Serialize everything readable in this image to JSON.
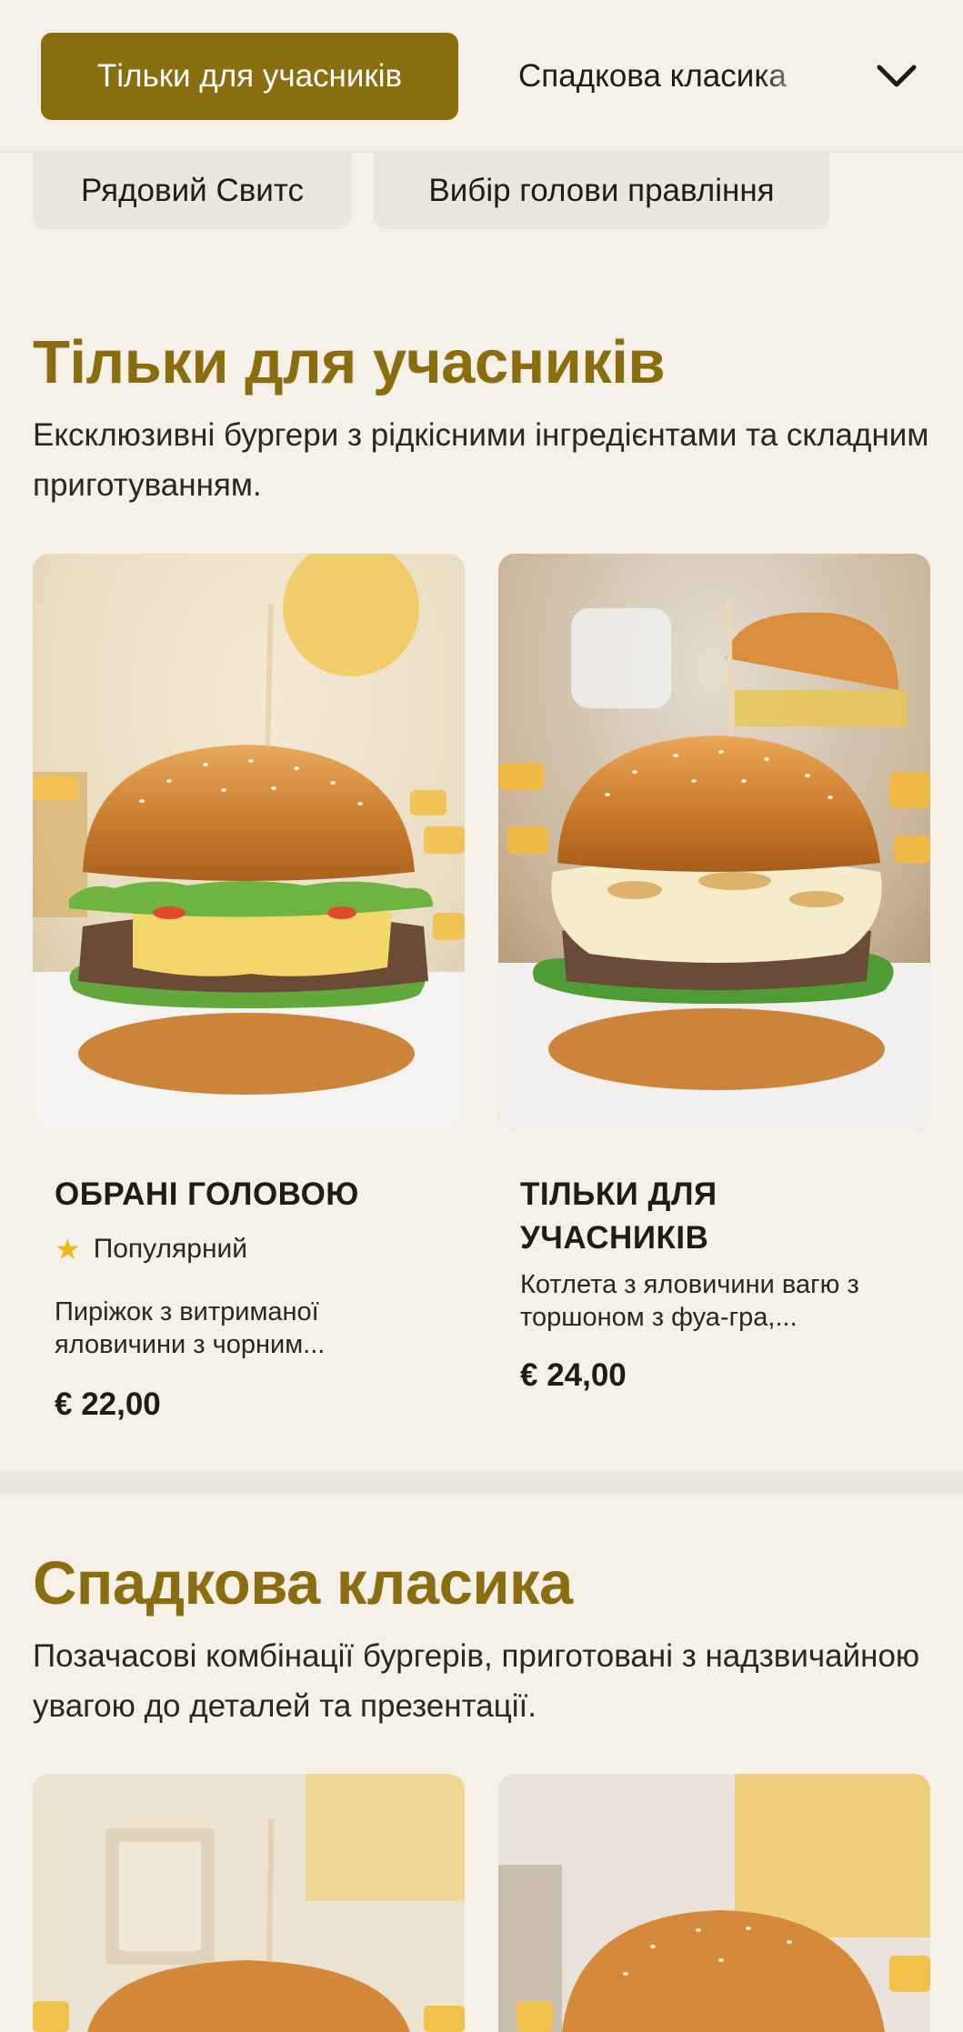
{
  "nav": {
    "active_category": "Тільки для учасників",
    "next_category": "Спадкова класика",
    "secondary": [
      "Рядовий Свитс",
      "Вибір голови правління"
    ]
  },
  "sections": [
    {
      "title": "Тільки для учасників",
      "description": "Ексклюзивні бургери з рідкісними інгредієнтами та складним приготуванням.",
      "items": [
        {
          "name": "ОБРАНІ ГОЛОВОЮ",
          "badge": "Популярний",
          "description": "Пиріжок з витриманої яловичини з чорним...",
          "price": "€ 22,00",
          "image": "burger-photo"
        },
        {
          "name": "ТІЛЬКИ ДЛЯ УЧАСНИКІВ",
          "description": "Котлета з яловичини вагю з торшоном з фуа-гра,...",
          "price": "€ 24,00",
          "image": "burger-photo"
        }
      ]
    },
    {
      "title": "Спадкова класика",
      "description": "Позачасові комбінації бургерів, приготовані з надзвичайною увагою до деталей та презентації."
    }
  ],
  "icons": {
    "expand": "chevron-down-icon",
    "badge": "star-icon"
  },
  "colors": {
    "accent": "#8a6d0f",
    "background": "#f5f1e9",
    "star": "#f3b619"
  }
}
